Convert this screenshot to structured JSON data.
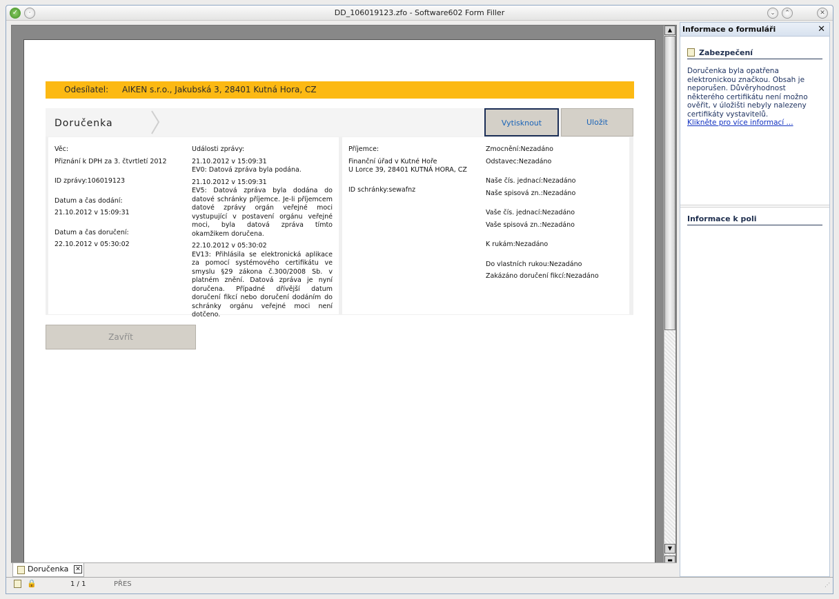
{
  "window": {
    "title": "DD_106019123.zfo - Software602 Form Filler"
  },
  "banner": {
    "label": "Odesílatel:",
    "value": "AIKEN s.r.o., Jakubská 3, 28401 Kutná Hora, CZ"
  },
  "form": {
    "title": "Doručenka",
    "print_label": "Vytisknout",
    "save_label": "Uložit",
    "close_label": "Zavřít"
  },
  "left": {
    "subject_label": "Věc:",
    "subject": "Přiznání k DPH za 3. čtvrtletí 2012",
    "id": "ID zprávy:106019123",
    "delivered_label": "Datum a čas dodání:",
    "delivered": "21.10.2012 v 15:09:31",
    "received_label": "Datum a čas doručení:",
    "received": "22.10.2012 v 05:30:02"
  },
  "events": {
    "label": "Události zprávy:",
    "items": [
      {
        "time": "21.10.2012 v 15:09:31",
        "text": "EV0: Datová zpráva byla podána."
      },
      {
        "time": "21.10.2012 v 15:09:31",
        "text": "EV5: Datová zpráva byla dodána do datové schránky příjemce. Je-li příjemcem datové zprávy orgán veřejné moci vystupující v postavení orgánu veřejné moci, byla datová zpráva tímto okamžikem doručena."
      },
      {
        "time": "22.10.2012 v 05:30:02",
        "text": "EV13: Přihlásila se elektronická aplikace za pomocí systémového certifikátu ve smyslu §29 zákona č.300/2008 Sb. v platném znění. Datová zpráva je nyní doručena. Případné dřívější datum doručení fikcí nebo doručení dodáním do schránky orgánu veřejné moci není dotčeno."
      }
    ]
  },
  "recipient": {
    "label": "Příjemce:",
    "name": "Finanční úřad v Kutné Hoře",
    "address": "U Lorce 39, 28401 KUTNÁ HORA, CZ",
    "box": "ID schránky:sewafnz"
  },
  "meta": {
    "authorization": "Zmocnění:Nezadáno",
    "paragraph": "Odstavec:Nezadáno",
    "our_ref": "Naše čís. jednací:Nezadáno",
    "our_file": "Naše spisová zn.:Nezadáno",
    "your_ref": "Vaše čís. jednací:Nezadáno",
    "your_file": "Vaše spisová zn.:Nezadáno",
    "attention": "K rukám:Nezadáno",
    "own_hands": "Do vlastních rukou:Nezadáno",
    "fiction": "Zakázáno doručení fikcí:Nezadáno"
  },
  "tabs": [
    {
      "label": "Doručenka"
    }
  ],
  "status": {
    "page": "1 / 1",
    "mode": "PŘES"
  },
  "sidebar": {
    "title": "Informace o formuláři",
    "security_title": "Zabezpečení",
    "security_text": "Doručenka byla opatřena elektronickou značkou. Obsah je neporušen. Důvěryhodnost některého certifikátu není možno ověřit, v úložišti nebyly nalezeny certifikáty vystavitelů.",
    "security_link": "Klikněte pro více informací ...",
    "field_title": "Informace k poli"
  }
}
